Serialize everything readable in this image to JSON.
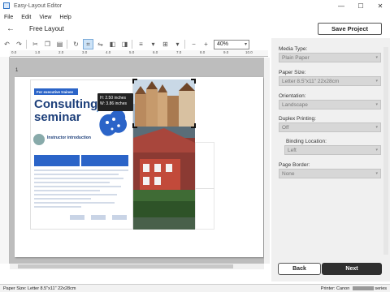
{
  "window": {
    "title": "Easy-Layout Editor",
    "minimize": "—",
    "maximize": "☐",
    "close": "✕"
  },
  "menu": [
    "File",
    "Edit",
    "View",
    "Help"
  ],
  "header": {
    "back_icon": "back-arrow-icon",
    "title": "Free Layout",
    "save_button": "Save Project"
  },
  "toolbar": {
    "zoom_value": "40%",
    "zoom_out": "−",
    "zoom_in": "+"
  },
  "ruler": [
    "0.0",
    "1.0",
    "2.0",
    "3.0",
    "4.0",
    "5.0",
    "6.0",
    "7.0",
    "8.0",
    "9.0",
    "10.0"
  ],
  "canvas": {
    "page_number": "1",
    "tooltip_height": "H: 2.50 inches",
    "tooltip_width": "W: 3.86 inches"
  },
  "flyer": {
    "tag": "For executive trainee",
    "headline_1": "Consulting",
    "headline_2": "seminar",
    "section": "Instructor introduction"
  },
  "settings": {
    "media_type_label": "Media Type:",
    "media_type_value": "Plain Paper",
    "paper_size_label": "Paper Size:",
    "paper_size_value": "Letter 8.5\"x11\" 22x28cm",
    "orientation_label": "Orientation:",
    "orientation_value": "Landscape",
    "duplex_label": "Duplex Printing:",
    "duplex_value": "Off",
    "binding_label": "Binding Location:",
    "binding_value": "Left",
    "border_label": "Page Border:",
    "border_value": "None"
  },
  "footer": {
    "back_button": "Back",
    "next_button": "Next"
  },
  "status": {
    "paper_size": "Paper Size: Letter 8.5\"x11\" 22x28cm",
    "printer_prefix": "Printer: Canon",
    "printer_suffix": "series"
  },
  "colors": {
    "accent": "#2b64c8",
    "next_button": "#2f2f2f",
    "disabled_field": "#d7d7d7"
  }
}
